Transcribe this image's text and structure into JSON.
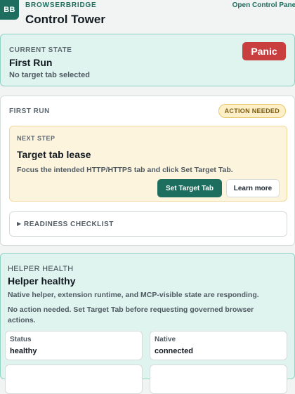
{
  "header": {
    "logo_text": "BB",
    "brand": "BROWSERBRIDGE",
    "title": "Control Tower",
    "open_panel_label": "Open Control Panel"
  },
  "current_state": {
    "eyebrow": "CURRENT STATE",
    "title": "First Run",
    "subtitle": "No target tab selected",
    "panic_label": "Panic"
  },
  "first_run": {
    "eyebrow": "FIRST RUN",
    "badge": "ACTION NEEDED",
    "next_step": {
      "eyebrow": "NEXT STEP",
      "title": "Target tab lease",
      "description": "Focus the intended HTTP/HTTPS tab and click Set Target Tab.",
      "primary_label": "Set Target Tab",
      "secondary_label": "Learn more"
    },
    "checklist_label": "READINESS CHECKLIST"
  },
  "helper_health": {
    "eyebrow": "HELPER HEALTH",
    "title": "Helper healthy",
    "line1": "Native helper, extension runtime, and MCP-visible state are responding.",
    "line2": "No action needed. Set Target Tab before requesting governed browser actions.",
    "stats": [
      {
        "key": "Status",
        "value": "healthy"
      },
      {
        "key": "Native",
        "value": "connected"
      }
    ]
  },
  "colors": {
    "accent": "#1e6e5f",
    "panic": "#c93f3f",
    "warning_bg": "#fdf4de",
    "healthy_bg": "#dff3ef"
  }
}
